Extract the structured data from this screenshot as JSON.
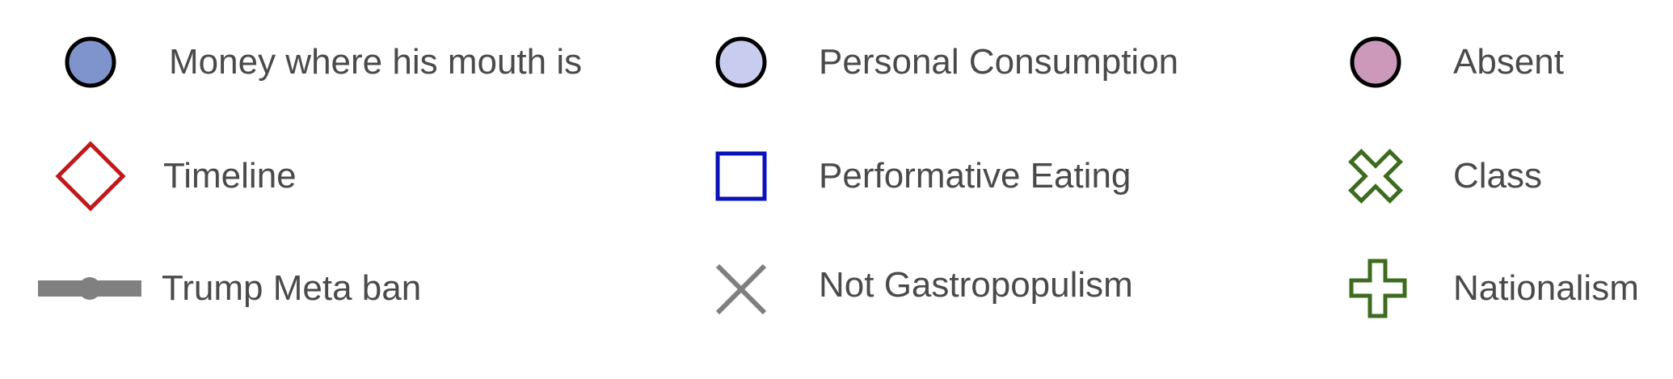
{
  "legend": {
    "items": [
      {
        "label": "Money where his mouth is",
        "icon": "filled-circle-icon",
        "color": "#7f93cc",
        "stroke": "#000000"
      },
      {
        "label": "Personal Consumption",
        "icon": "filled-circle-icon",
        "color": "#c8cdf0",
        "stroke": "#000000"
      },
      {
        "label": "Absent",
        "icon": "filled-circle-icon",
        "color": "#cc99bb",
        "stroke": "#000000"
      },
      {
        "label": "Timeline",
        "icon": "diamond-outline-icon",
        "color": "#c0191b"
      },
      {
        "label": "Performative Eating",
        "icon": "square-outline-icon",
        "color": "#0a12b8"
      },
      {
        "label": "Class",
        "icon": "x-cross-outline-icon",
        "color": "#3d6b1f"
      },
      {
        "label": "Trump Meta ban",
        "icon": "line-with-dot-icon",
        "color": "#808080"
      },
      {
        "label": "Not Gastropopulism",
        "icon": "x-mark-icon",
        "color": "#7f7f7f"
      },
      {
        "label": "Nationalism",
        "icon": "plus-cross-outline-icon",
        "color": "#3d6b1f"
      }
    ]
  }
}
